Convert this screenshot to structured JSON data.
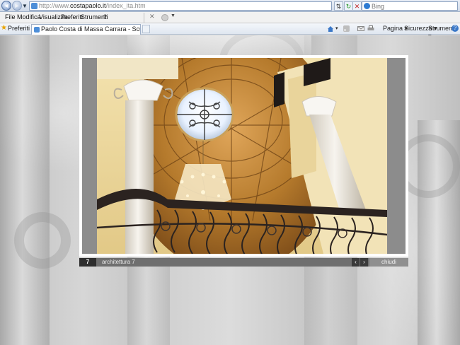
{
  "browser": {
    "url_prefix": "http://www.",
    "url_host": "costapaolo.it",
    "url_path": "/index_ita.htm",
    "search_placeholder": "Bing",
    "menu": [
      "File",
      "Modifica",
      "Visualizza",
      "Preferiti",
      "Strumenti",
      "?"
    ],
    "favorites_label": "Preferiti",
    "tab_title": "Paolo Costa di Massa Carrara - Scultura e Lavorazion...",
    "command_bar": {
      "page": "Pagina ▾",
      "security": "Sicurezza ▾",
      "tools": "Strumenti ▾"
    },
    "icons": [
      "back-arrow-icon",
      "forward-arrow-icon",
      "dropdown-icon",
      "page-icon",
      "refresh-icon",
      "compatibility-icon",
      "stop-icon",
      "bing-icon",
      "close-icon",
      "gear-icon",
      "favorites-star-icon",
      "home-icon",
      "feeds-icon",
      "mail-icon",
      "print-icon",
      "help-icon"
    ]
  },
  "gallery": {
    "image_number": "7",
    "image_title": "architettura 7",
    "prev_label": "‹",
    "next_label": "›",
    "close_label": "chiudi"
  },
  "colors": {
    "frame": "#ffffff",
    "caption_bar": "#6f6f6f",
    "dome_gold": "#b57a2c",
    "railing": "#2b2320"
  }
}
